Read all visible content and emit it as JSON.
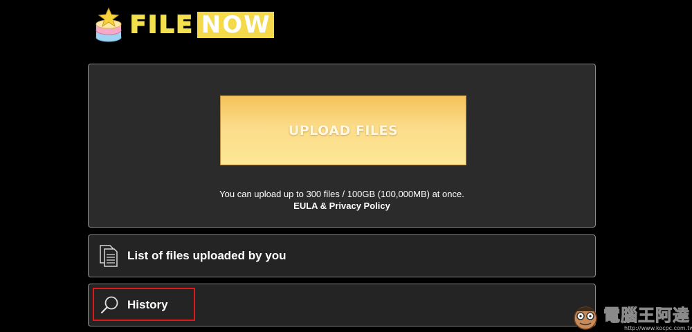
{
  "logo": {
    "part1": "FILE",
    "part2": "NOW"
  },
  "upload": {
    "button_label": "UPLOAD FILES",
    "info_text": "You can upload up to 300 files / 100GB (100,000MB) at once.",
    "eula_link": "EULA & Privacy Policy"
  },
  "menu": {
    "files_list_label": "List of files uploaded by you",
    "history_label": "History"
  },
  "watermark": {
    "cn_text": "電腦王阿達",
    "url": "http://www.kocpc.com.tw"
  },
  "colors": {
    "background": "#000000",
    "panel": "#2b2b2b",
    "panel_border": "#8a8a8a",
    "upload_button_top": "#f5c25a",
    "upload_button_bottom": "#fde795",
    "logo_yellow": "#f4e04d",
    "highlight": "#e01818"
  },
  "icons": {
    "logo": "stacked-disc-star-icon",
    "files_list": "documents-icon",
    "history": "search-magnifier-icon",
    "watermark": "cartoon-face-icon"
  }
}
